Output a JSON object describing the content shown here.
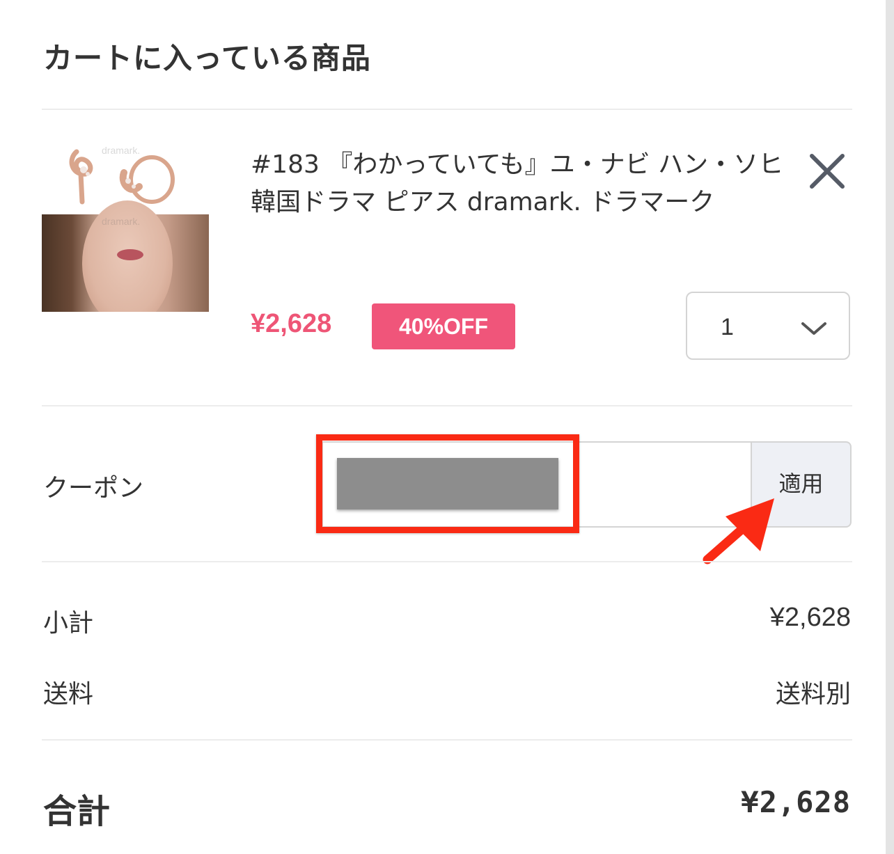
{
  "cart": {
    "title": "カートに入っている商品"
  },
  "item": {
    "name": "#183 『わかっていても』ユ・ナビ ハン・ソヒ 韓国ドラマ ピアス dramark. ドラマーク",
    "image_watermark": "dramark.",
    "price": "¥2,628",
    "discount_badge": "40%OFF",
    "quantity": "1",
    "remove_icon": "close-icon",
    "quantity_icon": "chevron-down-icon"
  },
  "coupon": {
    "label": "クーポン",
    "code": "",
    "apply_label": "適用"
  },
  "summary": {
    "subtotal_label": "小計",
    "subtotal_value": "¥2,628",
    "shipping_label": "送料",
    "shipping_value": "送料別",
    "total_label": "合計",
    "total_value": "¥2,628"
  },
  "colors": {
    "price": "#ee5576",
    "badge": "#f0557a",
    "annotation": "#fa2a14"
  }
}
